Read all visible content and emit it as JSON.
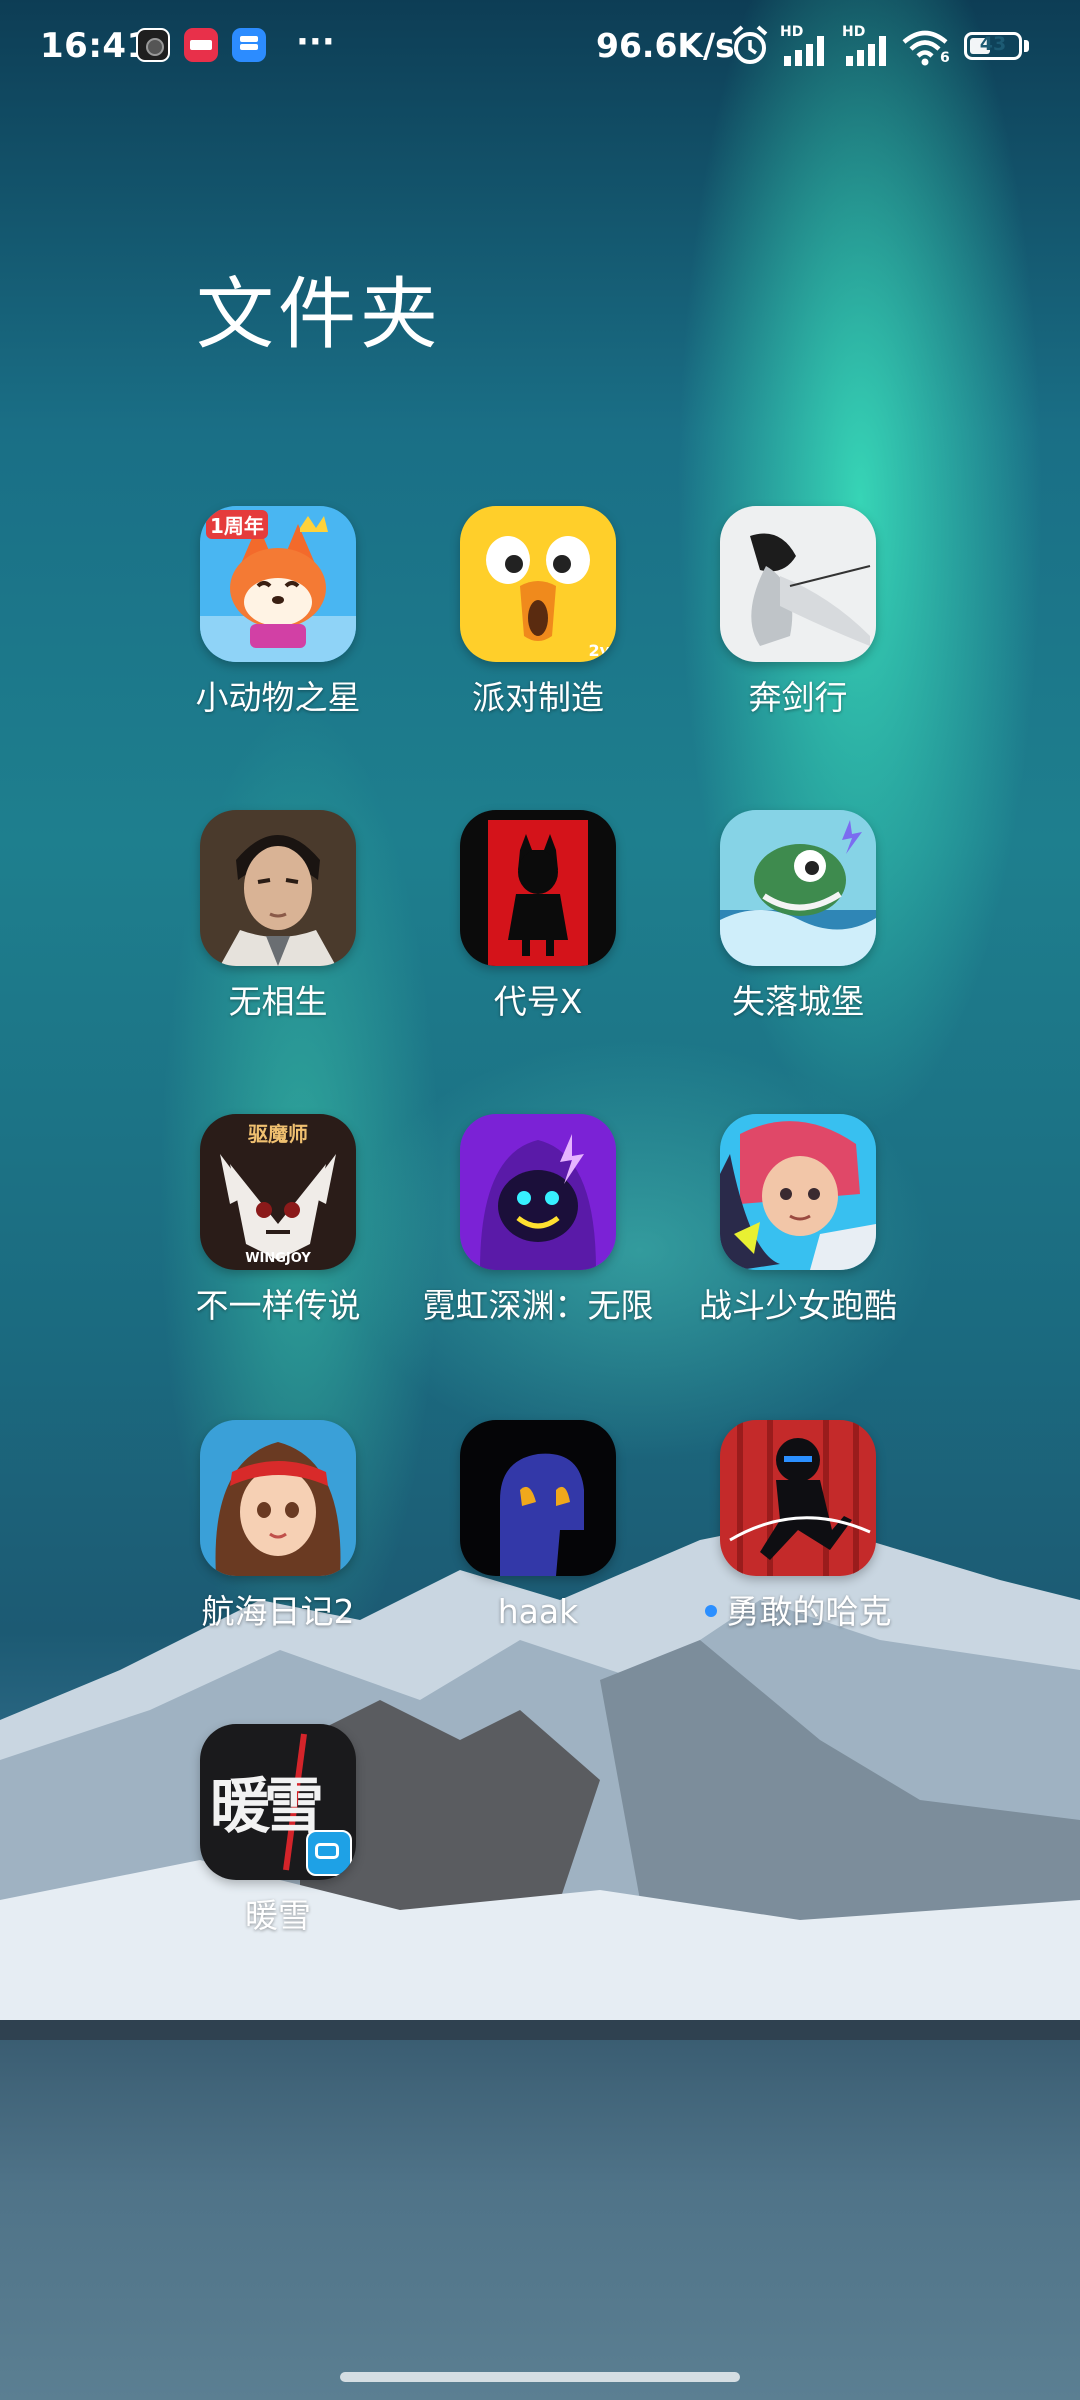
{
  "status_bar": {
    "time": "16:41",
    "more": "···",
    "net_speed": "96.6K/s",
    "signal_1_tag": "HD",
    "signal_2_tag": "HD",
    "wifi_tag": "6",
    "battery": "43",
    "battery_level_percent": 43
  },
  "folder": {
    "title": "文件夹"
  },
  "apps": [
    {
      "label": "小动物之星",
      "icon": "fox-character-icon",
      "icon_text": "1周年"
    },
    {
      "label": "派对制造",
      "icon": "yellow-bird-icon",
      "icon_text": "2v"
    },
    {
      "label": "奔剑行",
      "icon": "swordsman-icon"
    },
    {
      "label": "无相生",
      "icon": "portrait-man-icon"
    },
    {
      "label": "代号X",
      "icon": "red-silhouette-icon"
    },
    {
      "label": "失落城堡",
      "icon": "green-creature-icon"
    },
    {
      "label": "不一样传说",
      "icon": "skull-emblem-icon",
      "icon_text": "驱魔师",
      "icon_text_2": "WINGJOY"
    },
    {
      "label": "霓虹深渊：无限",
      "icon": "hooded-neon-icon"
    },
    {
      "label": "战斗少女跑酷",
      "icon": "anime-girl-icon"
    },
    {
      "label": "航海日记2",
      "icon": "pirate-girl-icon"
    },
    {
      "label": "haak",
      "icon": "dark-mask-icon"
    },
    {
      "label": "勇敢的哈克",
      "icon": "ninja-icon",
      "new_indicator": true
    },
    {
      "label": "暖雪",
      "icon": "calligraphy-icon",
      "icon_text": "暖雪"
    }
  ]
}
